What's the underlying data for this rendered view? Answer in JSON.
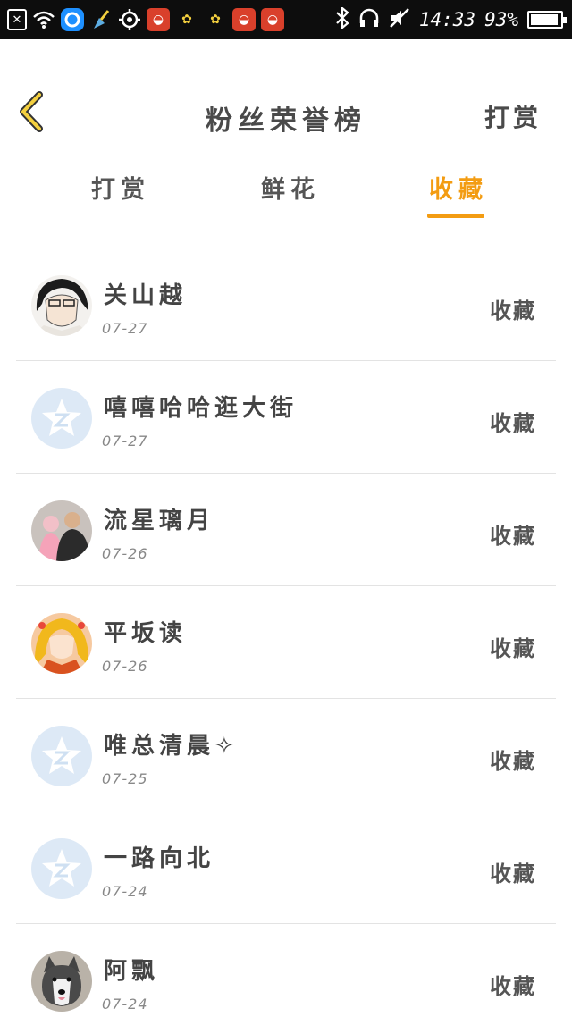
{
  "status_bar": {
    "time": "14:33",
    "battery_percent": "93%",
    "battery_level": 0.93,
    "left_icons": [
      "close-box-icon",
      "wifi-icon",
      "blue-app-icon",
      "broom-icon",
      "target-icon",
      "red-app-icon",
      "bulb-icon",
      "bulb-icon",
      "red-app-icon",
      "red-app-icon"
    ],
    "right_icons": [
      "bluetooth-icon",
      "headphones-icon",
      "mute-icon",
      "battery-icon"
    ]
  },
  "header": {
    "title": "粉丝荣誉榜",
    "action_label": "打赏"
  },
  "tabs": [
    {
      "label": "打赏",
      "active": false
    },
    {
      "label": "鲜花",
      "active": false
    },
    {
      "label": "收藏",
      "active": true
    }
  ],
  "colors": {
    "accent": "#f39c12",
    "text": "#4a4a4a",
    "divider": "#e3e3e3"
  },
  "fans": [
    {
      "name": "关山越",
      "date": "07-27",
      "action": "收藏",
      "avatar": "anime-boy-avatar"
    },
    {
      "name": "嘻嘻哈哈逛大街",
      "date": "07-27",
      "action": "收藏",
      "avatar": "default-star-avatar"
    },
    {
      "name": "流星璃月",
      "date": "07-26",
      "action": "收藏",
      "avatar": "family-photo-avatar"
    },
    {
      "name": "平坂读",
      "date": "07-26",
      "action": "收藏",
      "avatar": "anime-girl-avatar"
    },
    {
      "name": "唯总清晨✧",
      "date": "07-25",
      "action": "收藏",
      "avatar": "default-star-avatar"
    },
    {
      "name": "一路向北",
      "date": "07-24",
      "action": "收藏",
      "avatar": "default-star-avatar"
    },
    {
      "name": "阿飘",
      "date": "07-24",
      "action": "收藏",
      "avatar": "husky-dog-avatar"
    }
  ]
}
